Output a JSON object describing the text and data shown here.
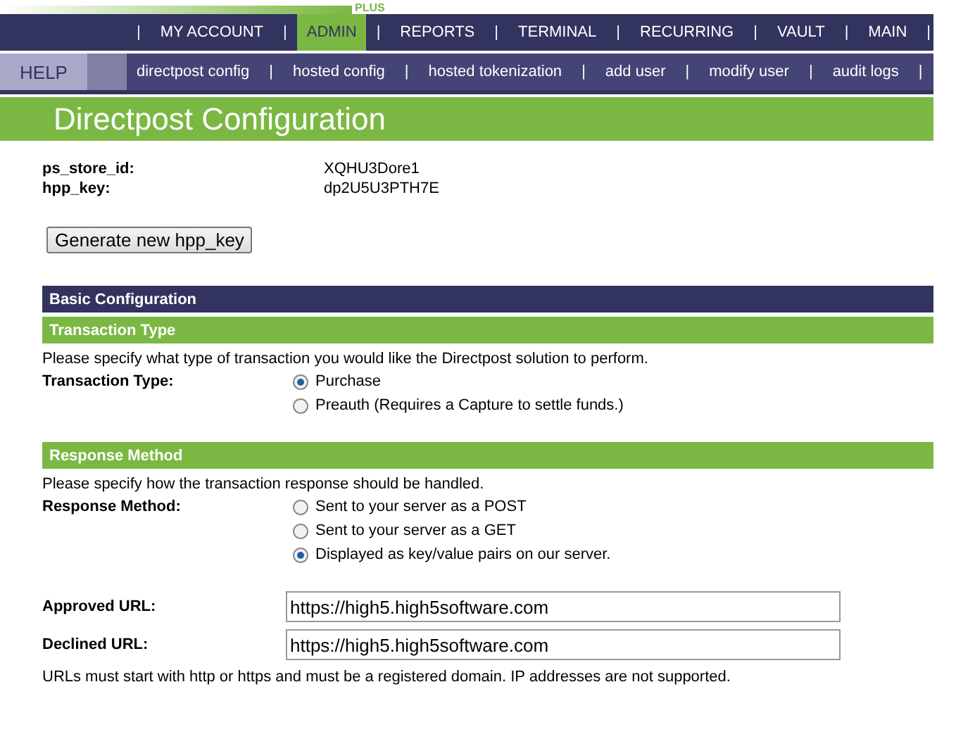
{
  "logo": {
    "text": "PLUS"
  },
  "main_nav": [
    {
      "kind": "separator",
      "text": "|"
    },
    {
      "kind": "link",
      "label": "MY ACCOUNT",
      "selected": false
    },
    {
      "kind": "separator",
      "text": "|"
    },
    {
      "kind": "link",
      "label": "ADMIN",
      "selected": true
    },
    {
      "kind": "separator",
      "text": "|"
    },
    {
      "kind": "link",
      "label": "REPORTS",
      "selected": false
    },
    {
      "kind": "separator",
      "text": "|"
    },
    {
      "kind": "link",
      "label": "TERMINAL",
      "selected": false
    },
    {
      "kind": "separator",
      "text": "|"
    },
    {
      "kind": "link",
      "label": "RECURRING",
      "selected": false
    },
    {
      "kind": "separator",
      "text": "|"
    },
    {
      "kind": "link",
      "label": "VAULT",
      "selected": false
    },
    {
      "kind": "separator",
      "text": "|"
    },
    {
      "kind": "link",
      "label": "MAIN",
      "selected": false
    },
    {
      "kind": "separator",
      "text": "|"
    }
  ],
  "help": {
    "label": "HELP"
  },
  "sub_nav": [
    {
      "kind": "link",
      "label": "directpost config"
    },
    {
      "kind": "separator",
      "text": "|"
    },
    {
      "kind": "link",
      "label": "hosted config"
    },
    {
      "kind": "separator",
      "text": "|"
    },
    {
      "kind": "link",
      "label": "hosted tokenization"
    },
    {
      "kind": "separator",
      "text": "|"
    },
    {
      "kind": "link",
      "label": "add user"
    },
    {
      "kind": "separator",
      "text": "|"
    },
    {
      "kind": "link",
      "label": "modify user"
    },
    {
      "kind": "separator",
      "text": "|"
    },
    {
      "kind": "link",
      "label": "audit logs"
    },
    {
      "kind": "separator",
      "text": "|"
    }
  ],
  "page_title": "Directpost Configuration",
  "info": [
    {
      "label": "ps_store_id:",
      "value": "XQHU3Dore1"
    },
    {
      "label": "hpp_key:",
      "value": "dp2U5U3PTH7E"
    }
  ],
  "generate_button": "Generate new hpp_key",
  "sections": [
    {
      "kind": "header",
      "title": "Basic Configuration"
    },
    {
      "kind": "radio",
      "title": "Transaction Type",
      "description": "Please specify what type of transaction you would like the Directpost solution to perform.",
      "label": "Transaction Type:",
      "options": [
        {
          "label": "Purchase",
          "selected": true
        },
        {
          "label": "Preauth (Requires a Capture to settle funds.)",
          "selected": false
        }
      ]
    },
    {
      "kind": "radio",
      "title": "Response Method",
      "description": "Please specify how the transaction response should be handled.",
      "label": "Response Method:",
      "options": [
        {
          "label": "Sent to your server as a POST",
          "selected": false
        },
        {
          "label": "Sent to your server as a GET",
          "selected": false
        },
        {
          "label": "Displayed as key/value pairs on our server.",
          "selected": true
        }
      ]
    }
  ],
  "url_fields": [
    {
      "label": "Approved URL:",
      "value": "https://high5.high5software.com"
    },
    {
      "label": "Declined URL:",
      "value": "https://high5.high5software.com"
    }
  ],
  "url_note": "URLs must start with http or https and must be a registered domain. IP addresses are not supported."
}
